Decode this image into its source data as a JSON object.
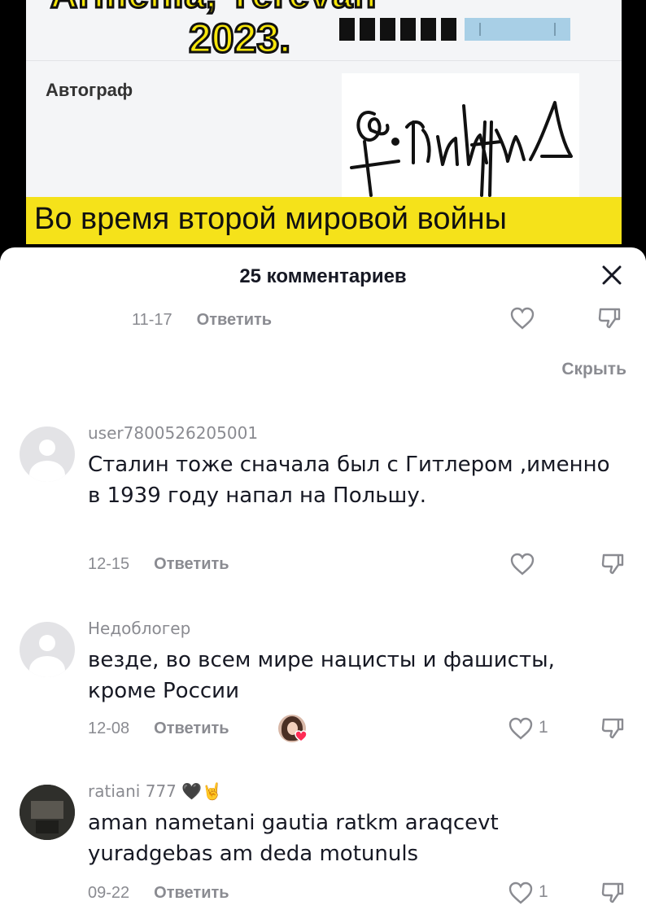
{
  "video": {
    "top_text": "Armenia, Yerevan",
    "year": "2023.",
    "autograph_label": "Автограф",
    "banner": "Во время второй мировой войны"
  },
  "comments_header": {
    "title": "25 комментариев",
    "close_icon": "close-icon"
  },
  "prev_reply_row": {
    "date": "11-17",
    "reply_label": "Ответить",
    "hide_label": "Скрыть"
  },
  "comments": [
    {
      "username": "user7800526205001",
      "text": "Сталин тоже сначала был с Гитлером ,именно в 1939 году напал на Польшу.",
      "date": "12-15",
      "reply_label": "Ответить",
      "likes": ""
    },
    {
      "username": "Недоблогер",
      "text": "везде, во всем мире нацисты и фашисты, кроме России",
      "date": "12-08",
      "reply_label": "Ответить",
      "likes": "1"
    },
    {
      "username": "ratiani 777 🖤🤘",
      "text": "aman nametani gautia ratkm araqcevt yuradgebas am deda motunuls",
      "date": "09-22",
      "reply_label": "Ответить",
      "likes": "1"
    }
  ],
  "colors": {
    "banner_yellow": "#f5e21a",
    "muted_gray": "#8a8b91",
    "text_dark": "#161823"
  }
}
